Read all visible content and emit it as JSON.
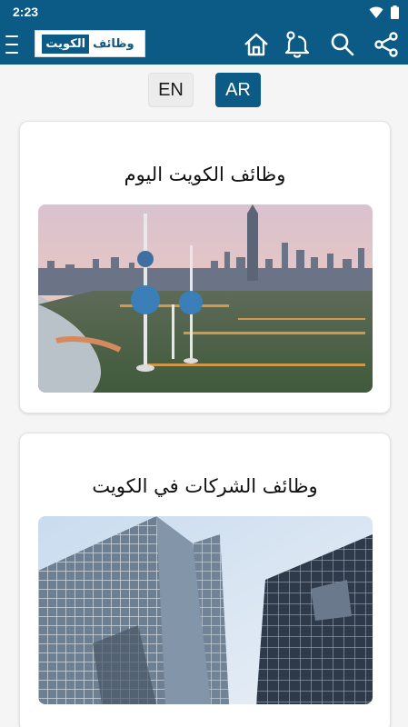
{
  "status_bar": {
    "time": "2:23",
    "icons": [
      "wifi-icon",
      "battery-icon"
    ]
  },
  "app_bar": {
    "logo_text_left": "الكويت",
    "logo_text_right": "وظائف",
    "actions": [
      "home-icon",
      "notification-bell-icon",
      "search-icon",
      "share-icon"
    ],
    "color": "#0c5a86"
  },
  "language": {
    "en_label": "EN",
    "ar_label": "AR",
    "selected": "AR"
  },
  "cards": [
    {
      "title": "وظائف الكويت اليوم",
      "image": "kuwait-towers-skyline"
    },
    {
      "title": "وظائف الشركات في الكويت",
      "image": "glass-skyscrapers"
    }
  ]
}
